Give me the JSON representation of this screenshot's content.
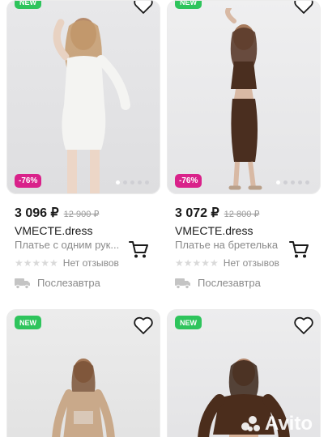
{
  "products": [
    {
      "badge": "NEW",
      "discount": "-76%",
      "price": "3 096 ₽",
      "old_price": "12 900 ₽",
      "brand": "VMECTE.dress",
      "name": "Платье с одним рук...",
      "reviews": "Нет отзывов",
      "delivery": "Послезавтра",
      "dress_color": "#f4f4f2"
    },
    {
      "badge": "NEW",
      "discount": "-76%",
      "price": "3 072 ₽",
      "old_price": "12 800 ₽",
      "brand": "VMECTE.dress",
      "name": "Платье на бретелька",
      "reviews": "Нет отзывов",
      "delivery": "Послезавтра",
      "dress_color": "#4a2e1f"
    },
    {
      "badge": "NEW",
      "dress_color": "#c9a98a"
    },
    {
      "badge": "NEW",
      "dress_color": "#4b2d1c"
    }
  ],
  "watermark": "Avito",
  "colors": {
    "badge_new": "#2ec45c",
    "discount": "#d9228a",
    "cart_icon": "#1a1a1a"
  }
}
